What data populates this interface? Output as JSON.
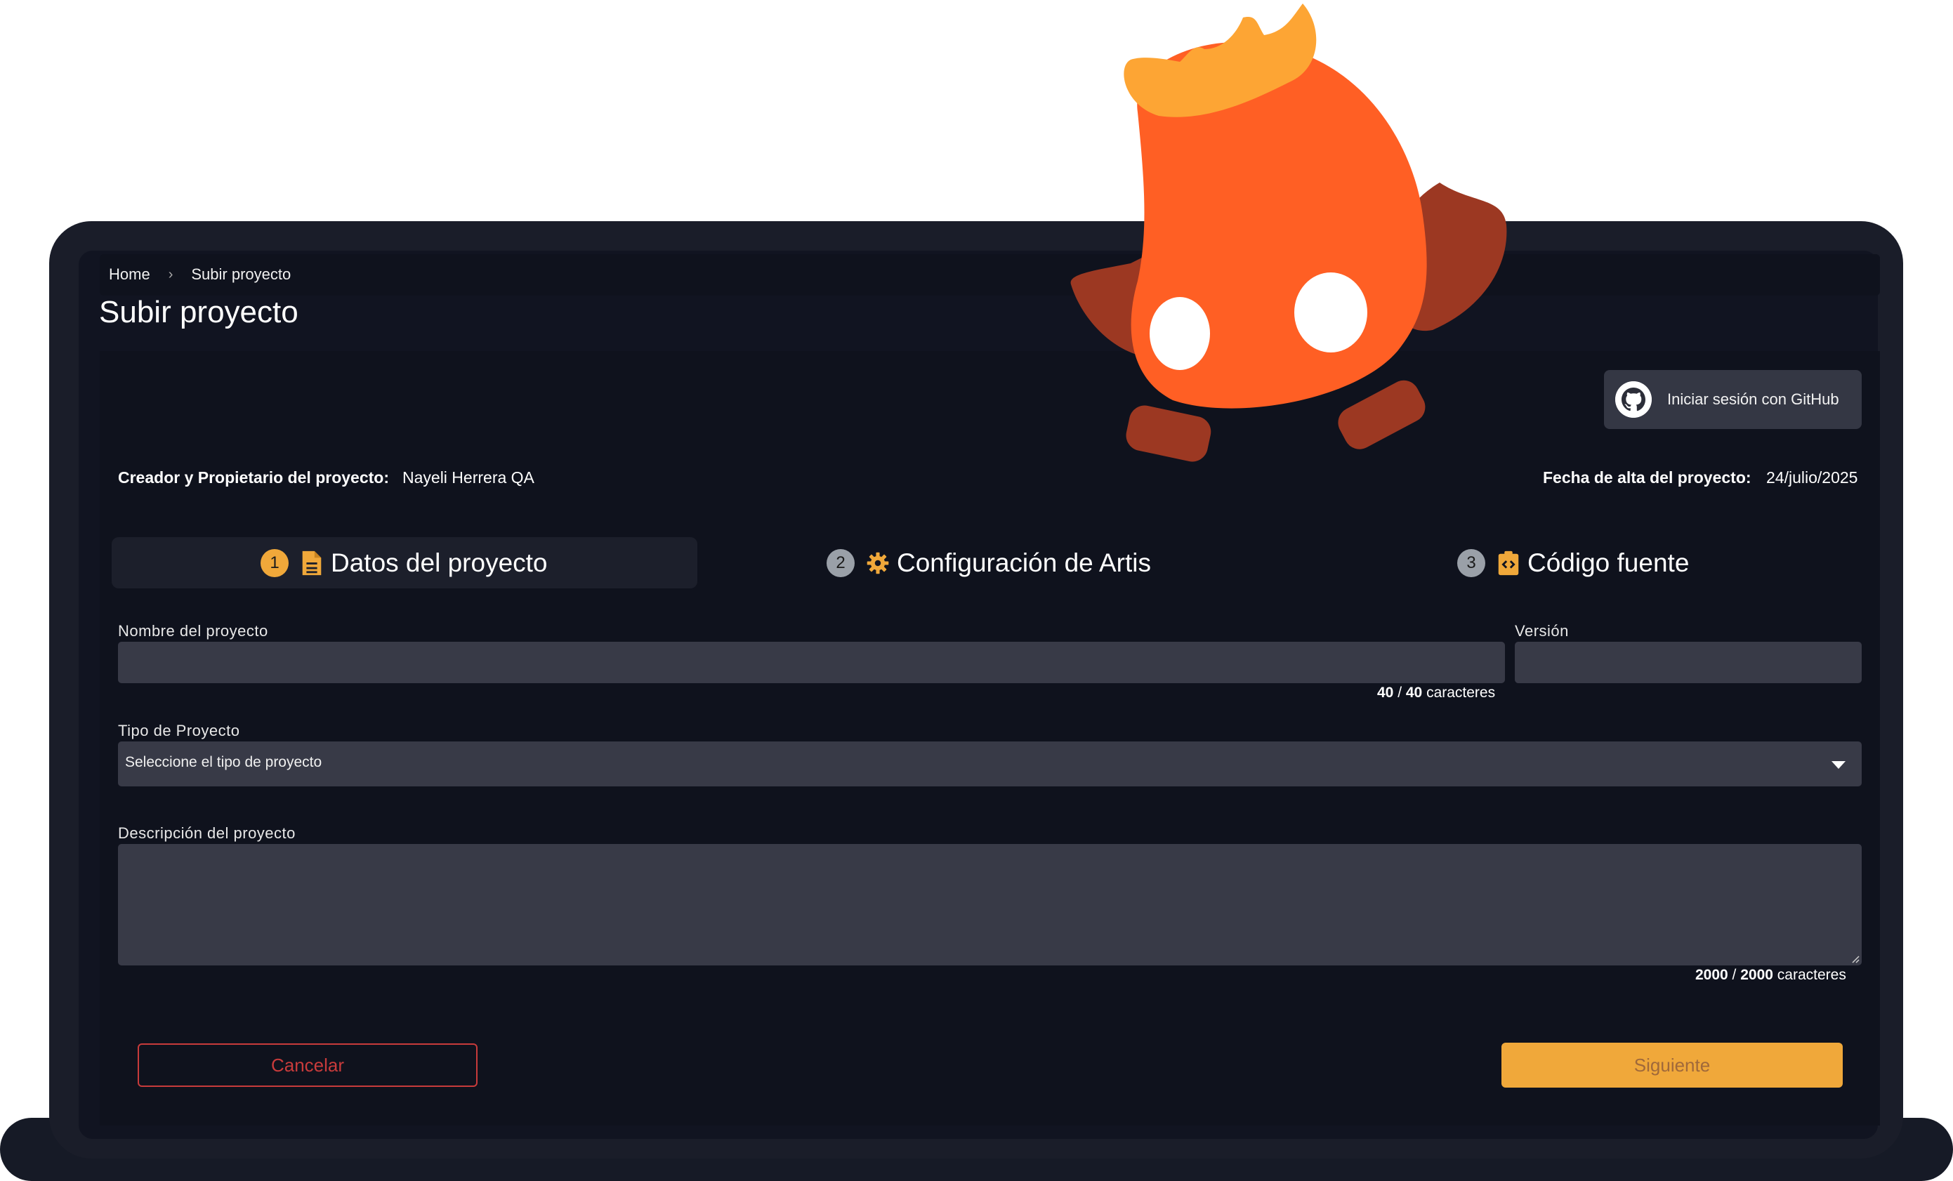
{
  "breadcrumb": {
    "home": "Home",
    "separator": "›",
    "current": "Subir proyecto"
  },
  "page": {
    "title": "Subir proyecto"
  },
  "github": {
    "label": "Iniciar sesión con GitHub",
    "icon": "github-icon"
  },
  "meta": {
    "owner_label": "Creador y Propietario del proyecto:",
    "owner_value": "Nayeli Herrera QA",
    "date_label": "Fecha de alta del proyecto:",
    "date_value": "24/julio/2025"
  },
  "steps": [
    {
      "num": "1",
      "label": "Datos del proyecto",
      "icon": "document-icon",
      "active": true
    },
    {
      "num": "2",
      "label": "Configuración de Artis",
      "icon": "gear-icon",
      "active": false
    },
    {
      "num": "3",
      "label": "Código fuente",
      "icon": "code-clipboard-icon",
      "active": false
    }
  ],
  "form": {
    "name_label": "Nombre del proyecto",
    "name_value": "",
    "name_counter": {
      "current": "40",
      "sep": " / ",
      "max": "40",
      "suffix": " caracteres"
    },
    "version_label": "Versión",
    "version_value": "",
    "type_label": "Tipo de Proyecto",
    "type_selected": "Seleccione el tipo de proyecto",
    "description_label": "Descripción del proyecto",
    "description_value": "",
    "description_counter": {
      "current": "2000",
      "sep": " / ",
      "max": "2000",
      "suffix": " caracteres"
    }
  },
  "actions": {
    "cancel": "Cancelar",
    "next": "Siguiente"
  },
  "colors": {
    "accent": "#f0a83a",
    "danger": "#c83b3b",
    "mascot_body": "#ff5f24",
    "mascot_dark": "#9c3822",
    "mascot_hair": "#fda534"
  }
}
